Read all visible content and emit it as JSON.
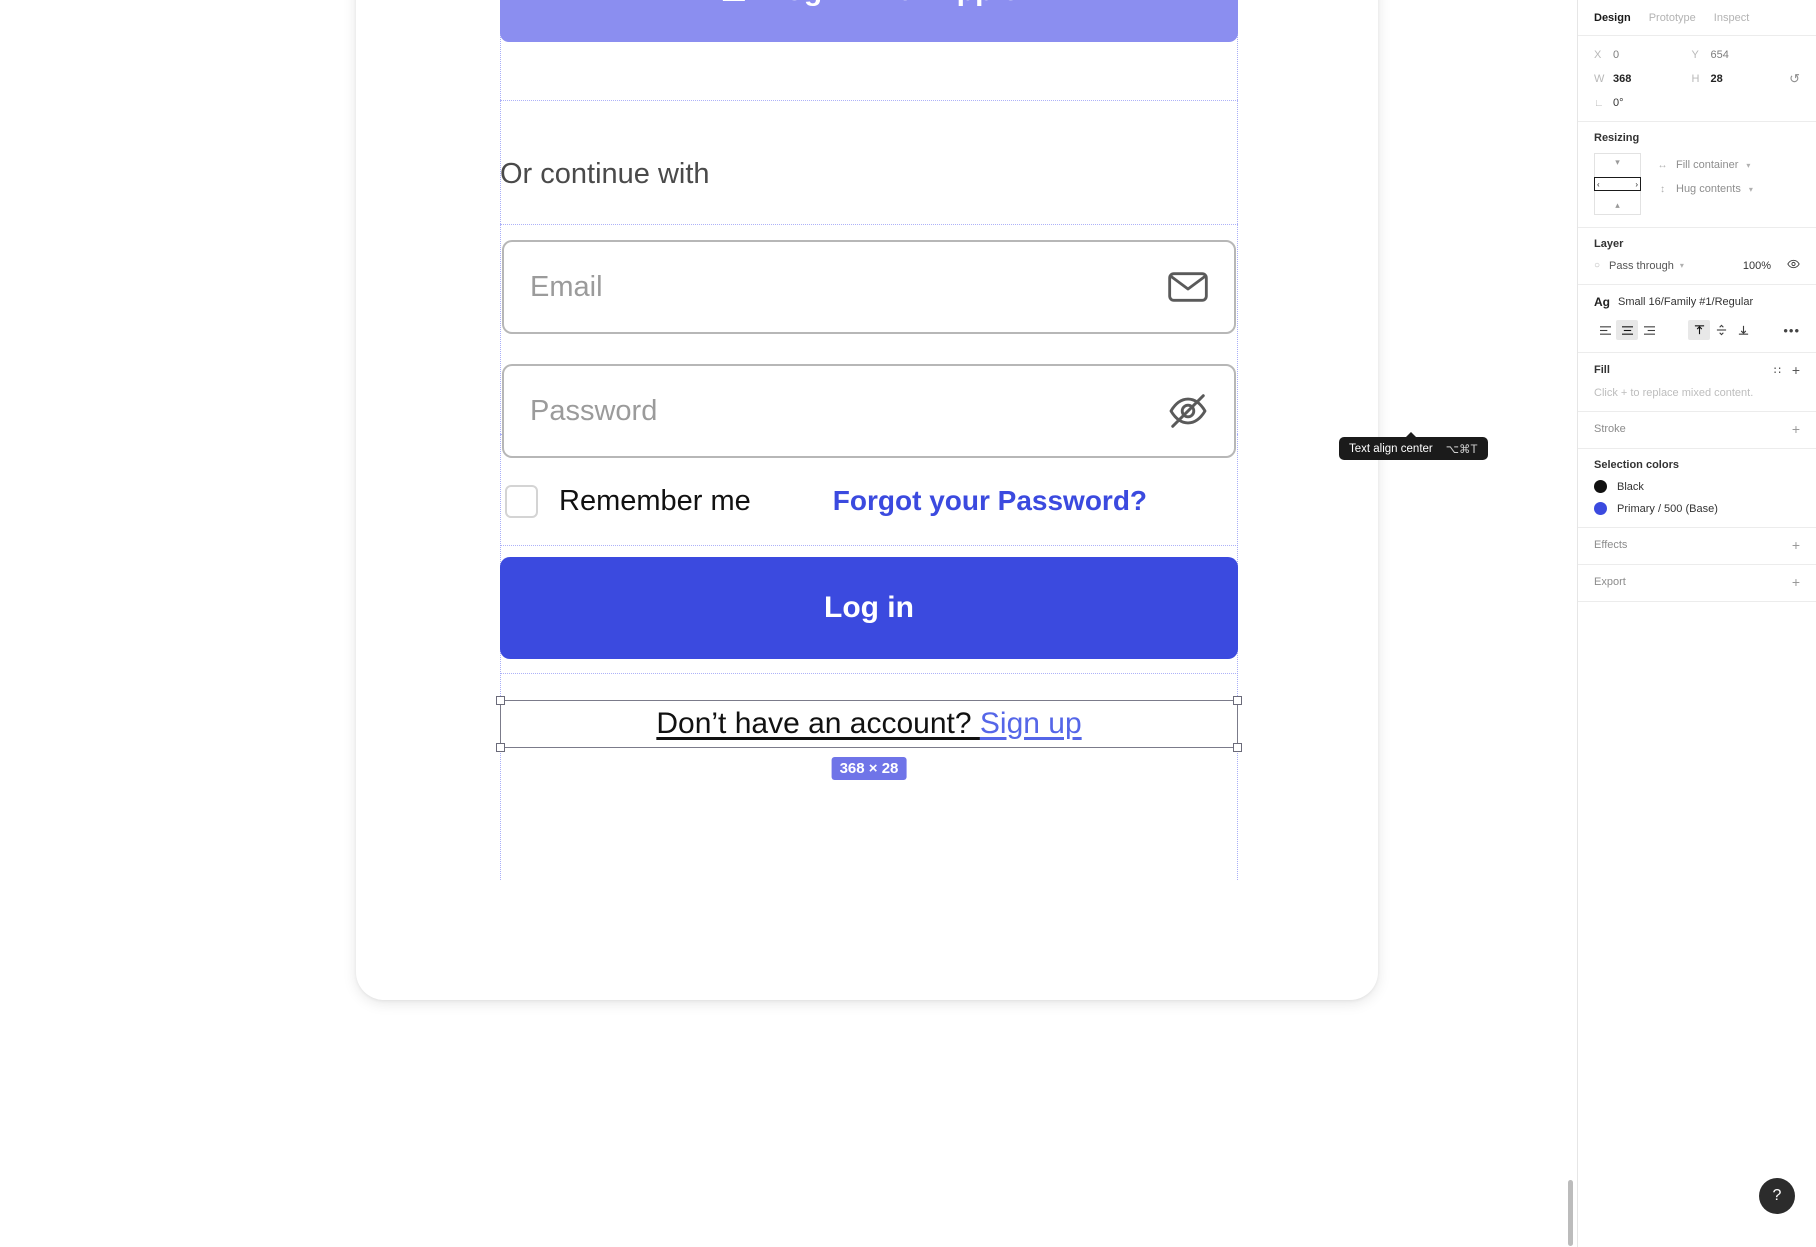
{
  "canvas": {
    "apple_button": {
      "label": "Log in with Apple",
      "icon": "apple-logo-icon",
      "bg": "#8B8EF0"
    },
    "or_continue": "Or continue with",
    "email_field": {
      "placeholder": "Email",
      "icon": "envelope-icon"
    },
    "password_field": {
      "placeholder": "Password",
      "icon": "eye-off-icon"
    },
    "remember": {
      "label": "Remember me",
      "checked": false
    },
    "forgot_link": "Forgot your Password?",
    "login_button": {
      "label": "Log in",
      "bg": "#3B4ADF"
    },
    "signup_row": {
      "prefix": "Don’t have an account? ",
      "link": "Sign up",
      "size_badge": "368 × 28"
    }
  },
  "panel": {
    "tabs": [
      {
        "label": "Design",
        "active": true
      },
      {
        "label": "Prototype",
        "active": false
      },
      {
        "label": "Inspect",
        "active": false
      }
    ],
    "properties": {
      "x_key": "X",
      "x_value": "0",
      "y_key": "Y",
      "y_value": "654",
      "w_key": "W",
      "w_value": "368",
      "h_key": "H",
      "h_value": "28",
      "rotation_key": "⌐",
      "rotation_value": "0°",
      "constrain_icon": "constrain-proportions-icon"
    },
    "resizing": {
      "title": "Resizing",
      "horizontal": "Fill container",
      "vertical": "Hug contents"
    },
    "layer": {
      "title": "Layer",
      "blend_mode": "Pass through",
      "opacity": "100%",
      "visibility_icon": "eye-icon"
    },
    "text": {
      "ag_label": "Ag",
      "style_name": "Small 16/Family #1/Regular",
      "align_left": "text-align-left-icon",
      "align_center": "text-align-center-icon",
      "align_right": "text-align-right-icon",
      "valign_top": "text-valign-top-icon",
      "valign_middle": "text-valign-middle-icon",
      "valign_bottom": "text-valign-bottom-icon",
      "more": "•••"
    },
    "fill": {
      "title": "Fill",
      "hint": "Click + to replace mixed content.",
      "styles_icon": "style-grid-icon",
      "add_icon": "plus-icon"
    },
    "stroke": {
      "title": "Stroke",
      "add_icon": "plus-icon"
    },
    "selection_colors": {
      "title": "Selection colors",
      "items": [
        {
          "name": "Black",
          "color": "#111111"
        },
        {
          "name": "Primary / 500 (Base)",
          "color": "#3B4ADF"
        }
      ]
    },
    "effects": {
      "title": "Effects",
      "add_icon": "plus-icon"
    },
    "export": {
      "title": "Export",
      "add_icon": "plus-icon"
    }
  },
  "tooltip": {
    "text": "Text align center",
    "shortcut": "⌥⌘T"
  },
  "help": {
    "glyph": "?"
  }
}
